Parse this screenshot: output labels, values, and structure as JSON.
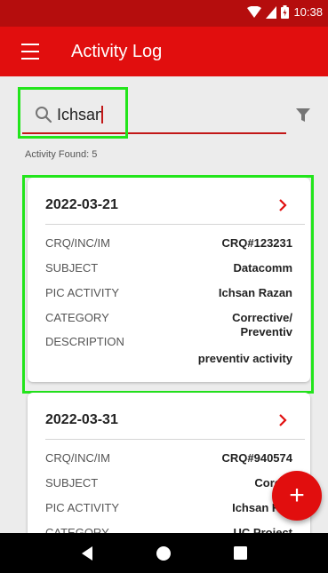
{
  "status_bar": {
    "time": "10:38"
  },
  "app_bar": {
    "title": "Activity Log"
  },
  "search": {
    "value": "Ichsan",
    "placeholder": ""
  },
  "summary": {
    "found_text": "Activity Found: 5"
  },
  "cards": [
    {
      "date": "2022-03-21",
      "rows": [
        {
          "label": "CRQ/INC/IM",
          "value": "CRQ#123231"
        },
        {
          "label": "SUBJECT",
          "value": "Datacomm"
        },
        {
          "label": "PIC ACTIVITY",
          "value": "Ichsan Razan"
        },
        {
          "label": "CATEGORY",
          "value": "Corrective/"
        },
        {
          "label": "",
          "value": "Preventiv"
        },
        {
          "label": "DESCRIPTION",
          "value": ""
        },
        {
          "label": "",
          "value": "preventiv activity"
        }
      ]
    },
    {
      "date": "2022-03-31",
      "rows": [
        {
          "label": "CRQ/INC/IM",
          "value": "CRQ#940574"
        },
        {
          "label": "SUBJECT",
          "value": "Core C"
        },
        {
          "label": "PIC ACTIVITY",
          "value": "Ichsan Raz"
        },
        {
          "label": "CATEGORY",
          "value": "UC Project"
        }
      ]
    }
  ],
  "fab": {
    "symbol": "+"
  },
  "colors": {
    "primary": "#e10e0e",
    "status_bar": "#b50d0d",
    "highlight": "#22e51b",
    "accent_line": "#c21717"
  },
  "icons": [
    "menu-icon",
    "search-icon",
    "filter-icon",
    "chevron-right-icon",
    "add-icon",
    "back-icon",
    "home-icon",
    "recents-icon",
    "wifi-icon",
    "signal-icon",
    "battery-icon"
  ]
}
